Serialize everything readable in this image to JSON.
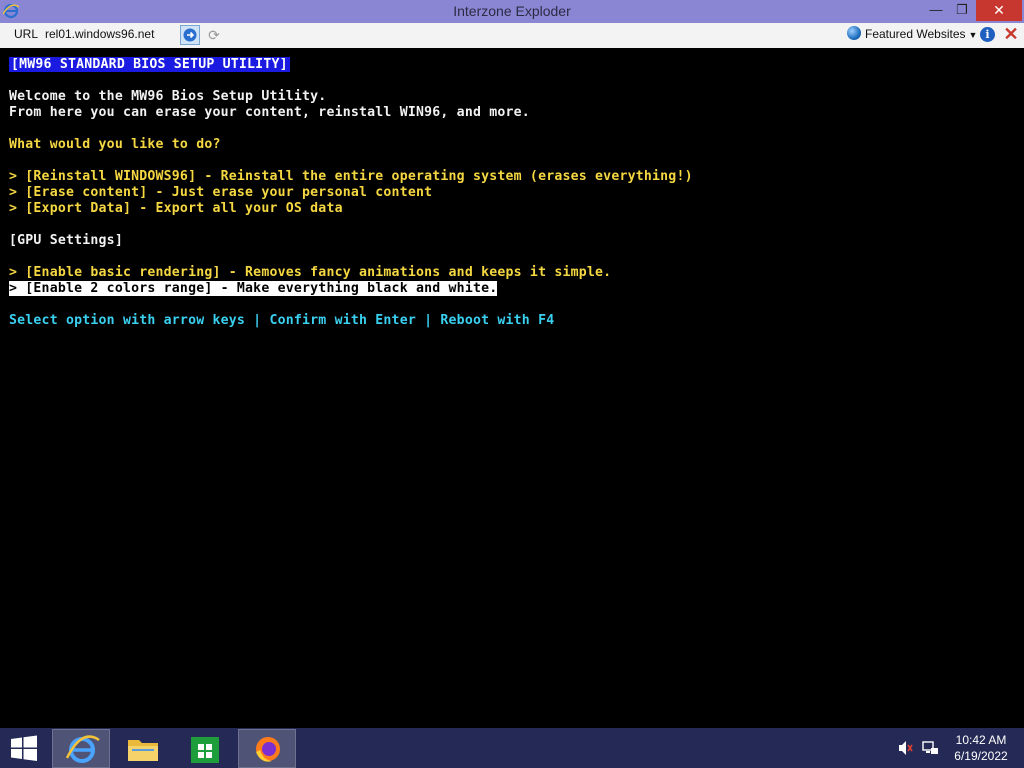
{
  "window": {
    "title": "Interzone Exploder",
    "min_glyph": "—",
    "max_glyph": "❐",
    "close_glyph": "✕"
  },
  "addressbar": {
    "url_label": "URL",
    "url": "rel01.windows96.net",
    "featured_label": "Featured Websites",
    "refresh_glyph": "⟳"
  },
  "bios": {
    "header": "[MW96 STANDARD BIOS SETUP UTILITY]",
    "welcome_1": "Welcome to the MW96 Bios Setup Utility.",
    "welcome_2": "From here you can erase your content, reinstall WIN96, and more.",
    "question": "What would you like to do?",
    "options": [
      "> [Reinstall WINDOWS96] - Reinstall the entire operating system (erases everything!)",
      "> [Erase content] - Just erase your personal content",
      "> [Export Data] - Export all your OS data"
    ],
    "gpu_heading": "[GPU Settings]",
    "gpu_options": [
      "> [Enable basic rendering] - Removes fancy animations and keeps it simple.",
      "> [Enable 2 colors range] - Make everything black and white."
    ],
    "footer": "Select option with arrow keys | Confirm with Enter | Reboot with F4"
  },
  "taskbar": {
    "clock_time": "10:42 AM",
    "clock_date": "6/19/2022"
  },
  "colors": {
    "titlebar": "#8b86d3",
    "taskbar": "#242a55",
    "bios_header_bg": "#1a1ae0",
    "bios_yellow": "#f5d742",
    "bios_cyan": "#3ad0f0"
  }
}
